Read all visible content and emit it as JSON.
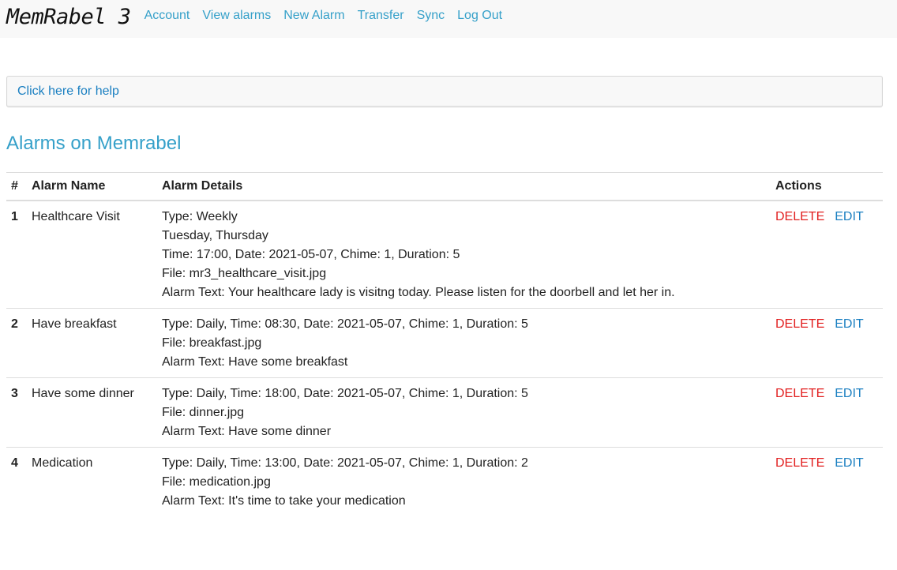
{
  "navbar": {
    "brand": "MemRabel 3",
    "links": [
      "Account",
      "View alarms",
      "New Alarm",
      "Transfer",
      "Sync",
      "Log Out"
    ]
  },
  "help": {
    "label": "Click here for help"
  },
  "page": {
    "title": "Alarms on Memrabel"
  },
  "table": {
    "headers": [
      "#",
      "Alarm Name",
      "Alarm Details",
      "Actions"
    ],
    "rows": [
      {
        "num": "1",
        "name": "Healthcare Visit",
        "details": [
          "Type: Weekly",
          "Tuesday, Thursday",
          "Time: 17:00, Date: 2021-05-07, Chime: 1, Duration: 5",
          "File: mr3_healthcare_visit.jpg",
          "Alarm Text: Your healthcare lady is visitng today. Please listen for the doorbell and let her in."
        ]
      },
      {
        "num": "2",
        "name": "Have breakfast",
        "details": [
          "Type: Daily, Time: 08:30, Date: 2021-05-07, Chime: 1, Duration: 5",
          "File: breakfast.jpg",
          "Alarm Text: Have some breakfast"
        ]
      },
      {
        "num": "3",
        "name": "Have some dinner",
        "details": [
          "Type: Daily, Time: 18:00, Date: 2021-05-07, Chime: 1, Duration: 5",
          "File: dinner.jpg",
          "Alarm Text: Have some dinner"
        ]
      },
      {
        "num": "4",
        "name": "Medication",
        "details": [
          "Type: Daily, Time: 13:00, Date: 2021-05-07, Chime: 1, Duration: 2",
          "File: medication.jpg",
          "Alarm Text: It's time to take your medication"
        ]
      }
    ],
    "actions": {
      "delete_label": "DELETE",
      "edit_label": "EDIT"
    }
  },
  "colors": {
    "accent": "#35a0c9",
    "link": "#1a7fc1",
    "danger": "#e11d1d"
  }
}
